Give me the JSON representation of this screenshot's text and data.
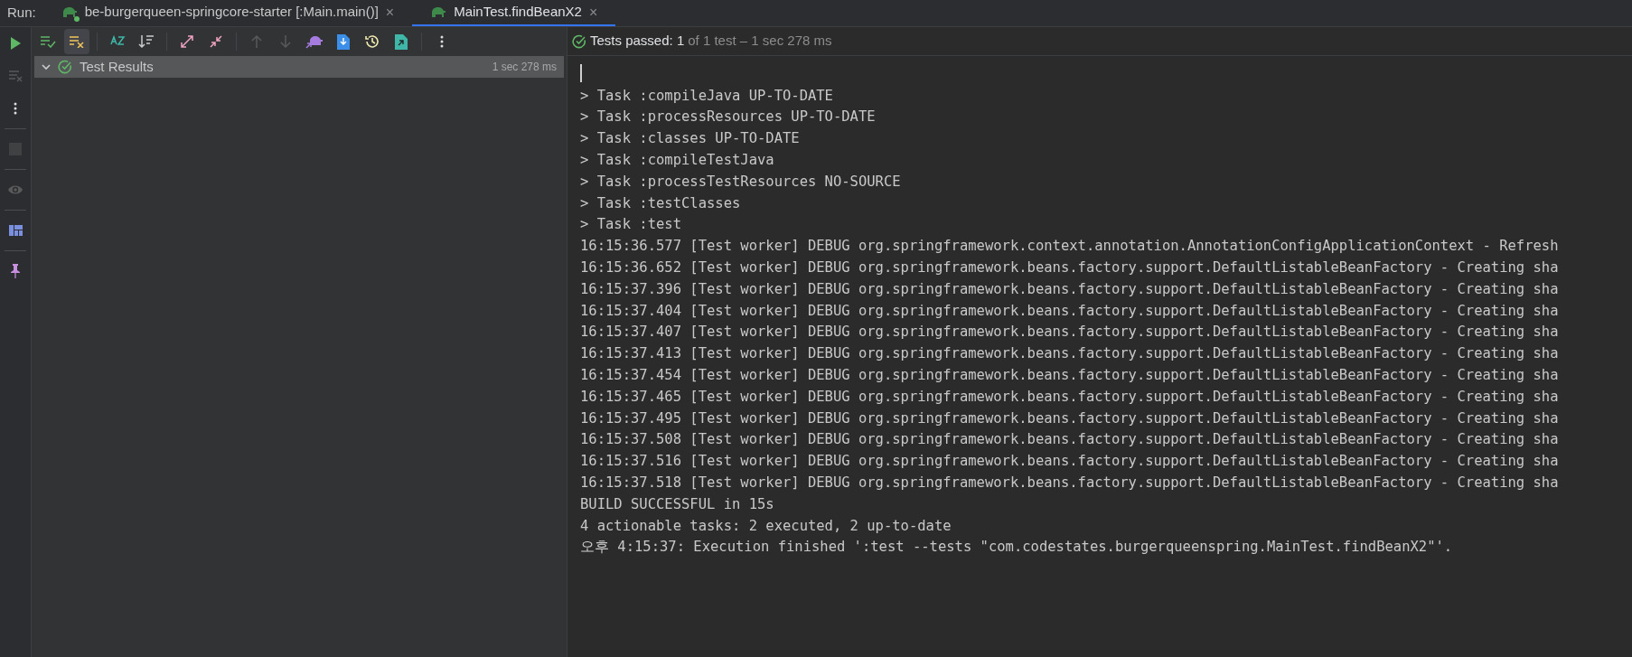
{
  "run_label": "Run:",
  "tabs": [
    {
      "label": "be-burgerqueen-springcore-starter [:Main.main()]",
      "selected": false,
      "running": true,
      "close": "×"
    },
    {
      "label": "MainTest.findBeanX2",
      "selected": true,
      "running": false,
      "close": "×"
    }
  ],
  "toolbar": {
    "show_passed_on": false,
    "show_ignored_on": true,
    "navigation_disabled": true
  },
  "test_tree": [
    {
      "label": "Test Results",
      "duration": "1 sec 278 ms",
      "expanded": true,
      "selected": true,
      "passed": true
    }
  ],
  "status": {
    "passed": true,
    "main": "Tests passed: 1",
    "detail": "of 1 test – 1 sec 278 ms"
  },
  "console": {
    "cursor": true,
    "lines": [
      "> Task :compileJava UP-TO-DATE",
      "> Task :processResources UP-TO-DATE",
      "> Task :classes UP-TO-DATE",
      "> Task :compileTestJava",
      "> Task :processTestResources NO-SOURCE",
      "> Task :testClasses",
      "> Task :test",
      "16:15:36.577 [Test worker] DEBUG org.springframework.context.annotation.AnnotationConfigApplicationContext - Refresh",
      "16:15:36.652 [Test worker] DEBUG org.springframework.beans.factory.support.DefaultListableBeanFactory - Creating sha",
      "16:15:37.396 [Test worker] DEBUG org.springframework.beans.factory.support.DefaultListableBeanFactory - Creating sha",
      "16:15:37.404 [Test worker] DEBUG org.springframework.beans.factory.support.DefaultListableBeanFactory - Creating sha",
      "16:15:37.407 [Test worker] DEBUG org.springframework.beans.factory.support.DefaultListableBeanFactory - Creating sha",
      "16:15:37.413 [Test worker] DEBUG org.springframework.beans.factory.support.DefaultListableBeanFactory - Creating sha",
      "16:15:37.454 [Test worker] DEBUG org.springframework.beans.factory.support.DefaultListableBeanFactory - Creating sha",
      "16:15:37.465 [Test worker] DEBUG org.springframework.beans.factory.support.DefaultListableBeanFactory - Creating sha",
      "16:15:37.495 [Test worker] DEBUG org.springframework.beans.factory.support.DefaultListableBeanFactory - Creating sha",
      "16:15:37.508 [Test worker] DEBUG org.springframework.beans.factory.support.DefaultListableBeanFactory - Creating sha",
      "16:15:37.516 [Test worker] DEBUG org.springframework.beans.factory.support.DefaultListableBeanFactory - Creating sha",
      "16:15:37.518 [Test worker] DEBUG org.springframework.beans.factory.support.DefaultListableBeanFactory - Creating sha",
      "BUILD SUCCESSFUL in 15s",
      "4 actionable tasks: 2 executed, 2 up-to-date",
      "오후 4:15:37: Execution finished ':test --tests \"com.codestates.burgerqueenspring.MainTest.findBeanX2\"'."
    ]
  }
}
